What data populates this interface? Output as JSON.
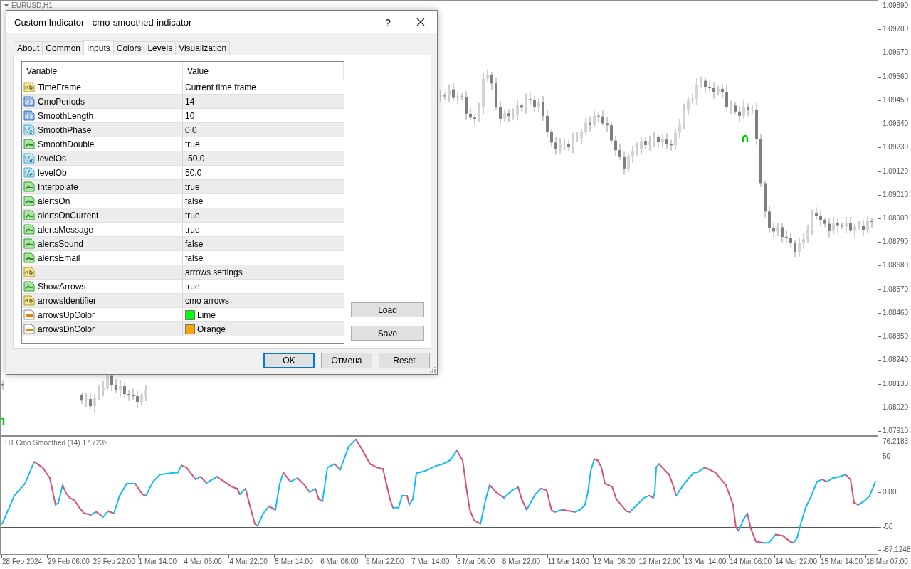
{
  "chart": {
    "symbol": "EURUSD,H1",
    "price_axis": [
      "1.09890",
      "1.09780",
      "1.09670",
      "1.09560",
      "1.09450",
      "1.09340",
      "1.09230",
      "1.09120",
      "1.09010",
      "1.08900",
      "1.08790",
      "1.08680",
      "1.08570",
      "1.08460",
      "1.08350",
      "1.08240",
      "1.08130",
      "1.08020",
      "1.07910"
    ],
    "indicator": {
      "title": "H1 Cmo Smoothed (14) 17.7239",
      "axis": [
        "76.2183",
        "50",
        "0.00",
        "-50",
        "-87.1248"
      ]
    },
    "time_axis": [
      "28 Feb 2024",
      "29 Feb 06:00",
      "29 Feb 22:00",
      "1 Mar 14:00",
      "4 Mar 06:00",
      "4 Mar 22:00",
      "5 Mar 14:00",
      "6 Mar 06:00",
      "6 Mar 22:00",
      "7 Mar 14:00",
      "8 Mar 06:00",
      "8 Mar 22:00",
      "11 Mar 14:00",
      "12 Mar 06:00",
      "12 Mar 22:00",
      "13 Mar 14:00",
      "14 Mar 06:00",
      "14 Mar 22:00",
      "15 Mar 14:00",
      "18 Mar 07:00"
    ]
  },
  "dialog": {
    "title": "Custom Indicator - cmo-smoothed-indicator",
    "help": "?",
    "tabs": [
      {
        "label": "About",
        "selected": false
      },
      {
        "label": "Common",
        "selected": false
      },
      {
        "label": "Inputs",
        "selected": true
      },
      {
        "label": "Colors",
        "selected": false
      },
      {
        "label": "Levels",
        "selected": false
      },
      {
        "label": "Visualization",
        "selected": false
      }
    ],
    "table": {
      "columns": [
        "Variable",
        "Value"
      ],
      "rows": [
        {
          "kind": "string",
          "variable": "TimeFrame",
          "value": "Current time frame"
        },
        {
          "kind": "int",
          "variable": "CmoPeriods",
          "value": "14"
        },
        {
          "kind": "int",
          "variable": "SmoothLength",
          "value": "10"
        },
        {
          "kind": "double",
          "variable": "SmoothPhase",
          "value": "0.0"
        },
        {
          "kind": "bool",
          "variable": "SmoothDouble",
          "value": "true"
        },
        {
          "kind": "double",
          "variable": "levelOs",
          "value": "-50.0"
        },
        {
          "kind": "double",
          "variable": "levelOb",
          "value": "50.0"
        },
        {
          "kind": "bool",
          "variable": "Interpolate",
          "value": "true"
        },
        {
          "kind": "bool",
          "variable": "alertsOn",
          "value": "false"
        },
        {
          "kind": "bool",
          "variable": "alertsOnCurrent",
          "value": "true"
        },
        {
          "kind": "bool",
          "variable": "alertsMessage",
          "value": "true"
        },
        {
          "kind": "bool",
          "variable": "alertsSound",
          "value": "false"
        },
        {
          "kind": "bool",
          "variable": "alertsEmail",
          "value": "false"
        },
        {
          "kind": "string",
          "variable": "__",
          "value": "arrows settings"
        },
        {
          "kind": "bool",
          "variable": "ShowArrows",
          "value": "true"
        },
        {
          "kind": "string",
          "variable": "arrowsIdentifier",
          "value": "cmo arrows"
        },
        {
          "kind": "color",
          "variable": "arrowsUpColor",
          "value": "Lime",
          "color": "#00ff00"
        },
        {
          "kind": "color",
          "variable": "arrowsDnColor",
          "value": "Orange",
          "color": "#ffa500"
        }
      ]
    },
    "side_buttons": [
      "Load",
      "Save"
    ],
    "buttons": [
      {
        "label": "OK",
        "default": true
      },
      {
        "label": "Отмена",
        "default": false
      },
      {
        "label": "Reset",
        "default": false
      }
    ]
  }
}
